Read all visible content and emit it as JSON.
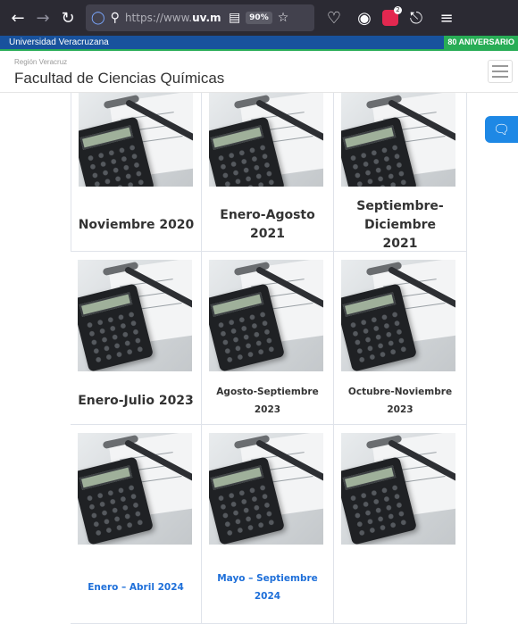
{
  "browser": {
    "url_prefix": "https://www.",
    "url_domain": "uv.m",
    "zoom": "90%"
  },
  "uv_bar": {
    "left_label": "Universidad Veracruzana",
    "right_label": "80 ANIVERSARIO"
  },
  "header": {
    "region": "Región Veracruz",
    "faculty": "Facultad de Ciencias Químicas"
  },
  "periods": [
    {
      "label": "Noviembre 2020"
    },
    {
      "label": "Enero-Agosto 2021"
    },
    {
      "label": "Septiembre-Diciembre 2021"
    },
    {
      "label": "Enero-Julio 2023"
    },
    {
      "label": "Agosto-Septiembre 2023"
    },
    {
      "label": "Octubre-Noviembre 2023"
    },
    {
      "label": "Enero – Abril 2024"
    },
    {
      "label": "Mayo – Septiembre 2024"
    }
  ],
  "icons": {
    "back": "arrow-left-icon",
    "forward": "arrow-right-icon",
    "reload": "reload-icon",
    "shield": "tracking-shield-icon",
    "lock": "lock-icon",
    "reader": "reader-view-icon",
    "bookmark": "star-icon",
    "pocket": "pocket-icon",
    "account": "account-icon",
    "extension": "extension-icon",
    "share": "share-icon",
    "menu": "menu-icon",
    "chat": "chat-icon"
  }
}
